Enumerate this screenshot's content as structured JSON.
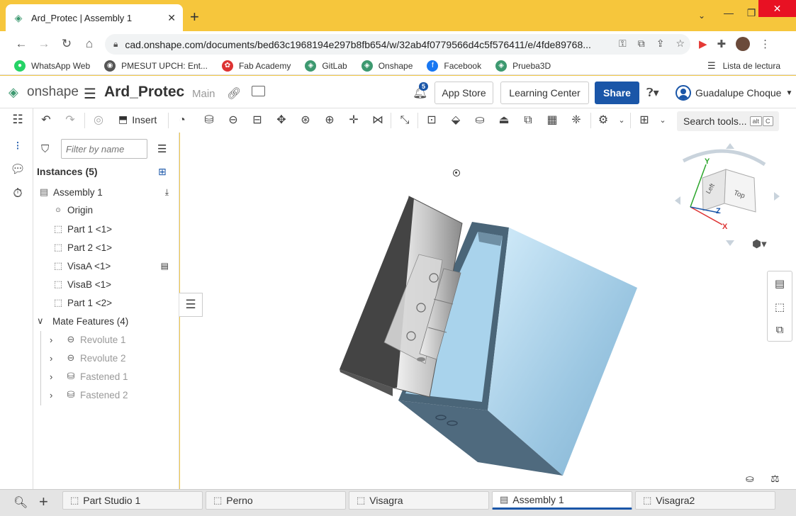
{
  "browser": {
    "tab_title": "Ard_Protec | Assembly 1",
    "url": "cad.onshape.com/documents/bed63c1968194e297b8fb654/w/32ab4f0779566d4c5f576411/e/4fde89768...",
    "bookmarks": [
      {
        "label": "WhatsApp Web",
        "color": "#25d366",
        "glyph": "●"
      },
      {
        "label": "PMESUT UPCH: Ent...",
        "color": "#555555",
        "glyph": "◉"
      },
      {
        "label": "Fab Academy",
        "color": "#d33",
        "glyph": "✿"
      },
      {
        "label": "GitLab",
        "color": "#3d9970",
        "glyph": "◈"
      },
      {
        "label": "Onshape",
        "color": "#3d9970",
        "glyph": "◈"
      },
      {
        "label": "Facebook",
        "color": "#1877f2",
        "glyph": "f"
      },
      {
        "label": "Prueba3D",
        "color": "#3d9970",
        "glyph": "◈"
      }
    ],
    "reading_list": "Lista de lectura"
  },
  "header": {
    "brand": "onshape",
    "doc_name": "Ard_Protec",
    "branch": "Main",
    "notifications": "5",
    "app_store": "App Store",
    "learning_center": "Learning Center",
    "share": "Share",
    "user_name": "Guadalupe Choque"
  },
  "toolbar": {
    "insert": "Insert",
    "search_tools": "Search tools...",
    "search_kbd_1": "alt",
    "search_kbd_2": "C"
  },
  "panel": {
    "filter_placeholder": "Filter by name",
    "instances_title": "Instances (5)",
    "items": [
      {
        "label": "Assembly 1"
      },
      {
        "label": "Origin"
      },
      {
        "label": "Part 1 <1>"
      },
      {
        "label": "Part 2 <1>"
      },
      {
        "label": "VisaA <1>"
      },
      {
        "label": "VisaB <1>"
      },
      {
        "label": "Part 1 <2>"
      }
    ],
    "mate_title": "Mate Features (4)",
    "mates": [
      {
        "label": "Revolute 1"
      },
      {
        "label": "Revolute 2"
      },
      {
        "label": "Fastened 1"
      },
      {
        "label": "Fastened 2"
      }
    ]
  },
  "viewcube": {
    "left": "Left",
    "top": "Top",
    "axis_x": "X",
    "axis_y": "Y",
    "axis_z": "Z"
  },
  "bottom_tabs": [
    {
      "label": "Part Studio 1"
    },
    {
      "label": "Perno"
    },
    {
      "label": "Visagra"
    },
    {
      "label": "Assembly 1"
    },
    {
      "label": "Visagra2"
    }
  ]
}
